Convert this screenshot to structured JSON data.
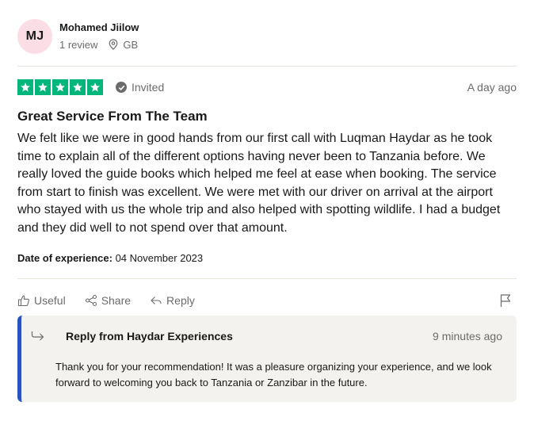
{
  "consumer": {
    "initials": "MJ",
    "name": "Mohamed Jiilow",
    "review_count": "1 review",
    "country": "GB"
  },
  "review": {
    "rating_stars": 5,
    "verification": "Invited",
    "date": "A day ago",
    "title": "Great Service From The Team",
    "body": "We felt like we were in good hands from our first call with Luqman Haydar as he took time to explain all of the different options having never been to Tanzania before. We really loved the guide books which helped me feel at ease when booking. The service from start to finish was excellent. We were met with our driver on arrival at the airport who stayed with us the whole trip and also helped with spotting wildlife. I had a budget and they did well to not spend over that amount.",
    "experience_label": "Date of experience:",
    "experience_date": "04 November 2023"
  },
  "actions": {
    "useful": "Useful",
    "share": "Share",
    "reply": "Reply"
  },
  "company_reply": {
    "title": "Reply from Haydar Experiences",
    "time": "9 minutes ago",
    "text": "Thank you for your recommendation! It was a pleasure organizing your experience, and we look forward to welcoming you back to Tanzania or Zanzibar in the future."
  },
  "colors": {
    "star_green": "#00b67a",
    "avatar_pink": "#fbdde6",
    "reply_accent": "#2a52be",
    "reply_bg": "#f3f2ee"
  },
  "icons": [
    "location-pin-icon",
    "star-icon",
    "check-circle-icon",
    "thumbs-up-icon",
    "share-icon",
    "reply-arrow-icon",
    "flag-icon",
    "reply-indicator-icon"
  ]
}
